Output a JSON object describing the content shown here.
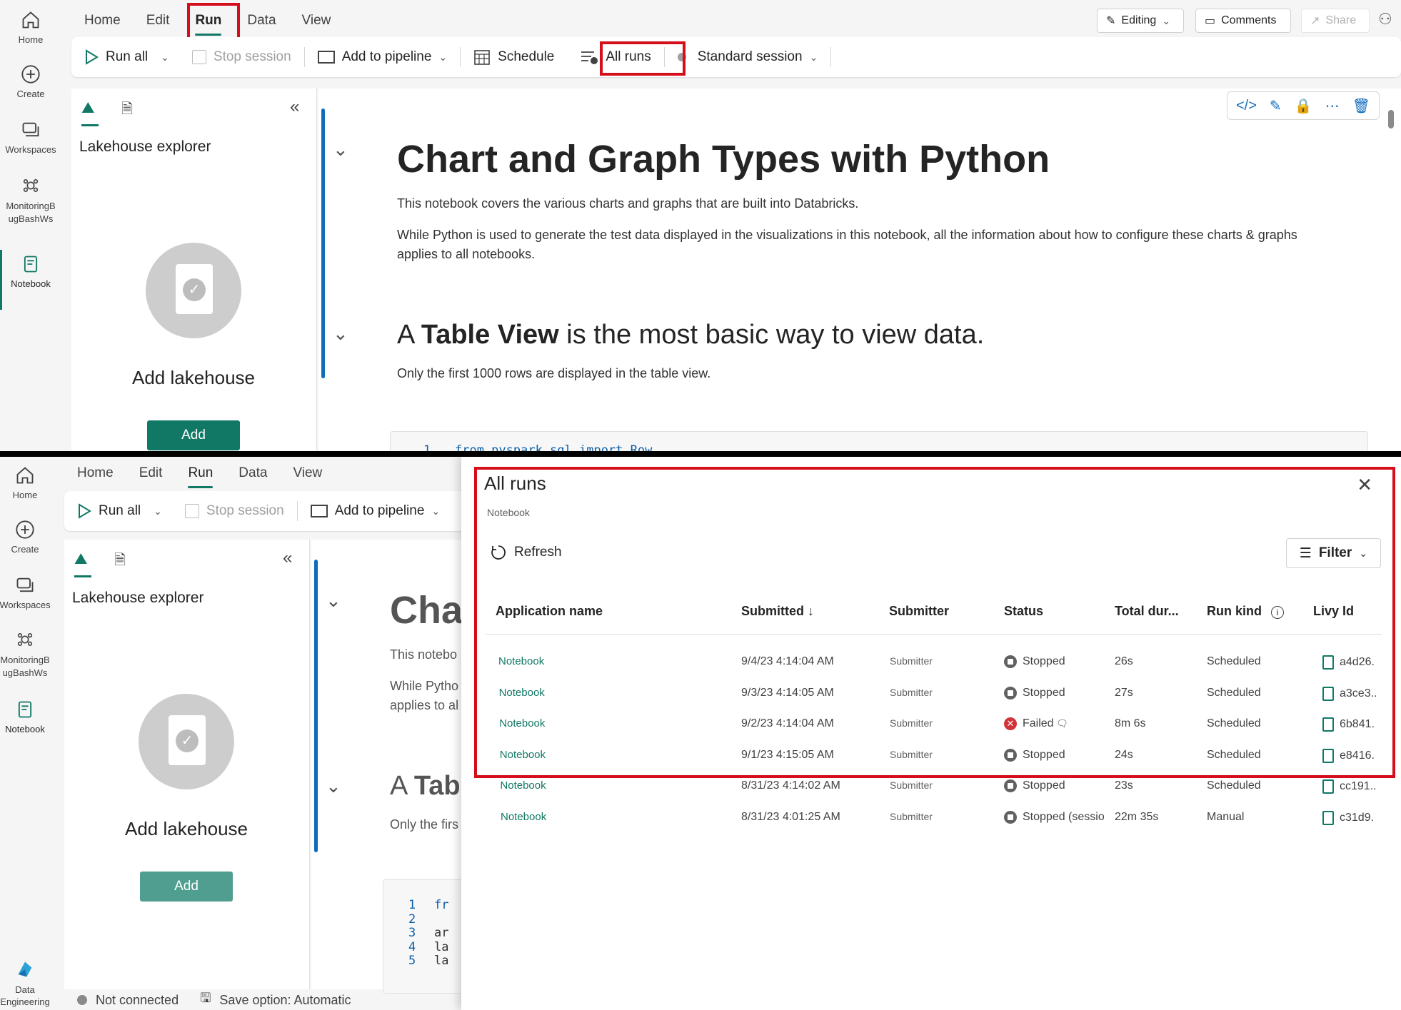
{
  "rail": {
    "items": [
      {
        "label": "Home",
        "icon": "home-icon"
      },
      {
        "label": "Create",
        "icon": "plus-circle-icon"
      },
      {
        "label": "Workspaces",
        "icon": "workspaces-icon"
      },
      {
        "label": "MonitoringB ugBashWs",
        "line1": "MonitoringB",
        "line2": "ugBashWs",
        "icon": "workspace-group-icon"
      },
      {
        "label": "Notebook",
        "icon": "notebook-icon"
      }
    ],
    "bottom_line1": "Data",
    "bottom_line2": "Engineering"
  },
  "menu": [
    "Home",
    "Edit",
    "Run",
    "Data",
    "View"
  ],
  "active_menu": "Run",
  "ribbon": {
    "run_all": "Run all",
    "stop_session": "Stop session",
    "add_to_pipeline": "Add to pipeline",
    "schedule": "Schedule",
    "all_runs": "All runs",
    "standard_session": "Standard session"
  },
  "top_right": {
    "editing": "Editing",
    "comments": "Comments",
    "share": "Share"
  },
  "explorer": {
    "title": "Lakehouse explorer",
    "add_lakehouse": "Add lakehouse",
    "add_button": "Add"
  },
  "notebook": {
    "title": "Chart and Graph Types with Python",
    "title_partial": "Cha",
    "intro": "This notebook covers the various charts and graphs that are built into Databricks.",
    "intro_partial": "This notebo",
    "info_line1": "While Python is used to generate the test data displayed in the visualizations in this notebook, all the information about how to configure these charts & graphs",
    "info_line2": "applies to all notebooks.",
    "info_partial1": "While Pytho",
    "info_partial2": "applies to al",
    "h2_prefix": "A ",
    "h2_bold": "Table View",
    "h2_suffix": " is the most basic way to view data.",
    "h2_partial_prefix": "A ",
    "h2_partial_bold": "Tab",
    "table_note": "Only the first 1000 rows are displayed in the table view.",
    "table_note_partial": "Only the firs",
    "code_top_ln": "1",
    "code_top": "from pyspark.sql import Row",
    "code_lines": [
      {
        "n": "1",
        "t": "fr"
      },
      {
        "n": "2",
        "t": ""
      },
      {
        "n": "3",
        "t": "ar"
      },
      {
        "n": "4",
        "t": "la"
      },
      {
        "n": "5",
        "t": "la"
      }
    ]
  },
  "statusbar": {
    "connection": "Not connected",
    "save": "Save option: Automatic"
  },
  "all_runs": {
    "title": "All runs",
    "subtitle": "Notebook",
    "refresh": "Refresh",
    "filter": "Filter",
    "columns": [
      "Application name",
      "Submitted ↓",
      "Submitter",
      "Status",
      "Total dur...",
      "Run kind",
      "Livy Id"
    ],
    "rows": [
      {
        "app": "Notebook",
        "submitted": "9/4/23 4:14:04 AM",
        "submitter": "Submitter",
        "status": "Stopped",
        "status_kind": "stopped",
        "duration": "26s",
        "kind": "Scheduled",
        "livy": "a4d26."
      },
      {
        "app": "Notebook",
        "submitted": "9/3/23 4:14:05 AM",
        "submitter": "Submitter",
        "status": "Stopped",
        "status_kind": "stopped",
        "duration": "27s",
        "kind": "Scheduled",
        "livy": "a3ce3.."
      },
      {
        "app": "Notebook",
        "submitted": "9/2/23 4:14:04 AM",
        "submitter": "Submitter",
        "status": "Failed",
        "status_kind": "failed",
        "duration": "8m 6s",
        "kind": "Scheduled",
        "livy": "6b841."
      },
      {
        "app": "Notebook",
        "submitted": "9/1/23 4:15:05 AM",
        "submitter": "Submitter",
        "status": "Stopped",
        "status_kind": "stopped",
        "duration": "24s",
        "kind": "Scheduled",
        "livy": "e8416."
      },
      {
        "app": "Notebook",
        "submitted": "8/31/23 4:14:02 AM",
        "submitter": "Submitter",
        "status": "Stopped",
        "status_kind": "stopped",
        "duration": "23s",
        "kind": "Scheduled",
        "livy": "cc191.."
      },
      {
        "app": "Notebook",
        "submitted": "8/31/23 4:01:25 AM",
        "submitter": "Submitter",
        "status": "Stopped (sessio",
        "status_kind": "stopped",
        "duration": "22m 35s",
        "kind": "Manual",
        "livy": "c31d9."
      }
    ]
  },
  "colors": {
    "accent": "#117865",
    "highlight": "#d40f1b",
    "link": "#0f6cbd",
    "failed": "#d13438"
  }
}
